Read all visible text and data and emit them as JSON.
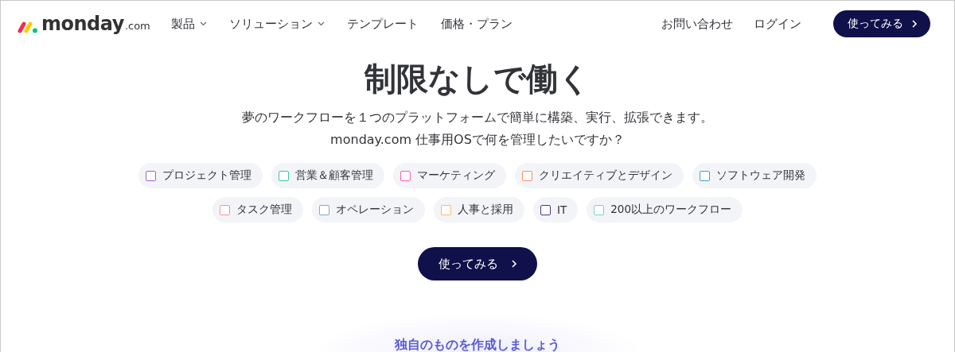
{
  "logo": {
    "name": "monday",
    "suffix": ".com"
  },
  "nav": {
    "items": [
      {
        "label": "製品",
        "has_menu": true
      },
      {
        "label": "ソリューション",
        "has_menu": true
      },
      {
        "label": "テンプレート",
        "has_menu": false
      },
      {
        "label": "価格・プラン",
        "has_menu": false
      }
    ],
    "links": [
      "お問い合わせ",
      "ログイン"
    ],
    "cta": "使ってみる"
  },
  "hero": {
    "title": "制限なしで働く",
    "subtitle": [
      "夢のワークフローを１つのプラットフォームで簡単に構築、実行、拡張できます。",
      "monday.com 仕事用OSで何を管理したいですか？"
    ],
    "chips": [
      [
        {
          "label": "プロジェクト管理",
          "color": "#a25ddc",
          "checked": false
        },
        {
          "label": "営業＆顧客管理",
          "color": "#33cc99",
          "checked": false
        },
        {
          "label": "マーケティング",
          "color": "#ff5ac4",
          "checked": false
        },
        {
          "label": "クリエイティブとデザイン",
          "color": "#ff8c5a",
          "checked": false
        },
        {
          "label": "ソフトウェア開発",
          "color": "#3aa0d8",
          "checked": false
        }
      ],
      [
        {
          "label": "タスク管理",
          "color": "#ff9090",
          "checked": false
        },
        {
          "label": "オペレーション",
          "color": "#80aac4",
          "checked": false
        },
        {
          "label": "人事と採用",
          "color": "#fdbb63",
          "checked": false
        },
        {
          "label": "IT",
          "color": "#50348c",
          "checked": false
        },
        {
          "label": "200以上のワークフロー",
          "color": "#6fd6cc",
          "checked": false
        }
      ]
    ],
    "cta": "使ってみる"
  },
  "section_heading": "独自のものを作成しましょう"
}
